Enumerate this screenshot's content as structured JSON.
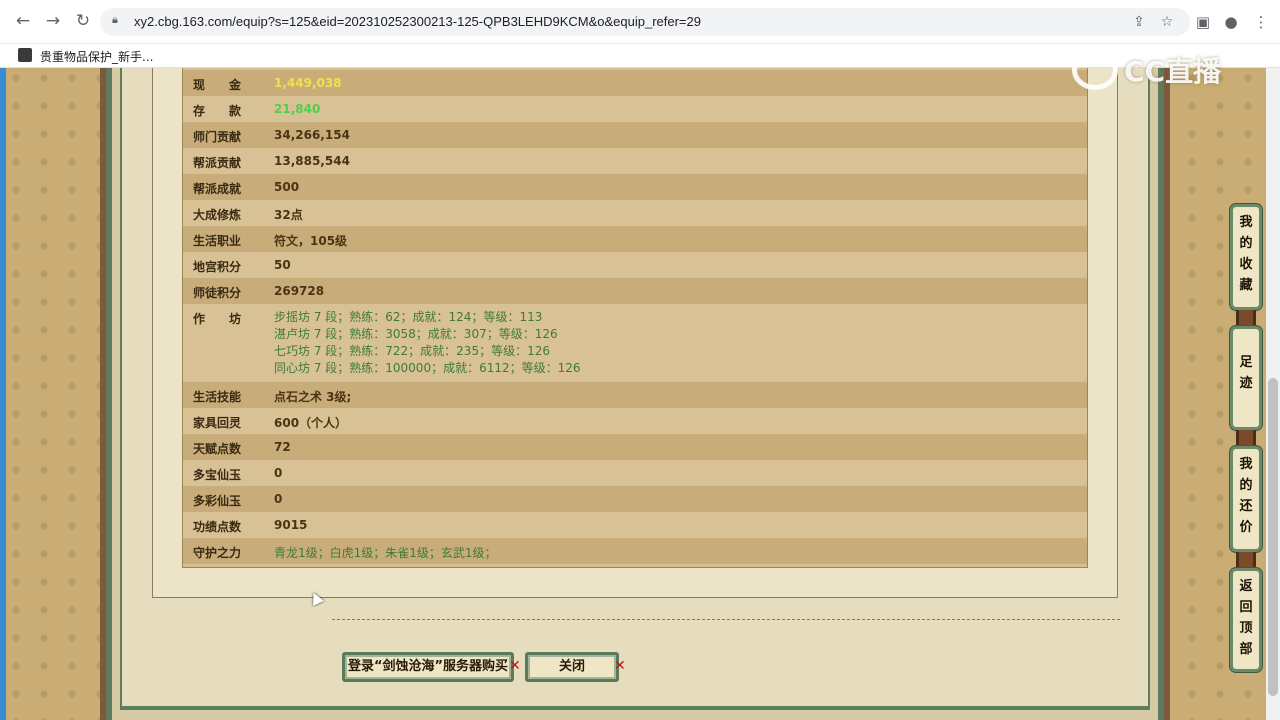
{
  "browser": {
    "url": "xy2.cbg.163.com/equip?s=125&eid=202310252300213-125-QPB3LEHD9KCM&o&equip_refer=29",
    "bookmark_label": "贵重物品保护_新手...",
    "nav_icons": [
      "back-icon",
      "forward-icon",
      "reload-icon"
    ],
    "right_icons": [
      "share-icon",
      "star-icon",
      "sidebar-icon",
      "profile-icon",
      "menu-icon"
    ]
  },
  "watermark": {
    "text": "CC直播"
  },
  "table": {
    "rows": [
      {
        "label": "现　　金",
        "value": "1,449,038",
        "style": "yellow"
      },
      {
        "label": "存　　款",
        "value": "21,840",
        "style": "bright-green"
      },
      {
        "label": "师门贡献",
        "value": "34,266,154"
      },
      {
        "label": "帮派贡献",
        "value": "13,885,544"
      },
      {
        "label": "帮派成就",
        "value": "500"
      },
      {
        "label": "大成修炼",
        "value": "32点"
      },
      {
        "label": "生活职业",
        "value": "符文，105级"
      },
      {
        "label": "地宫积分",
        "value": "50"
      },
      {
        "label": "师徒积分",
        "value": "269728"
      }
    ],
    "workshop": {
      "label": "作　　坊",
      "lines": [
        "步摇坊 7 段；熟练：62；成就：124；等级：113",
        "湛卢坊 7 段；熟练：3058；成就：307；等级：126",
        "七巧坊 7 段；熟练：722；成就：235；等级：126",
        "同心坊 7 段；熟练：100000；成就：6112；等级：126"
      ]
    },
    "rows_after": [
      {
        "label": "生活技能",
        "value": "点石之术 3级;"
      },
      {
        "label": "家具回灵",
        "value": "600（个人）"
      },
      {
        "label": "天赋点数",
        "value": "72"
      },
      {
        "label": "多宝仙玉",
        "value": "0"
      },
      {
        "label": "多彩仙玉",
        "value": "0"
      },
      {
        "label": "功绩点数",
        "value": "9015"
      },
      {
        "label": "守护之力",
        "value": "青龙1级；白虎1级；朱雀1级；玄武1级；",
        "style": "green"
      }
    ]
  },
  "buttons": {
    "login": "登录“剑蚀沧海”服务器购买",
    "close": "关闭"
  },
  "side_buttons": [
    {
      "label": "我的收藏"
    },
    {
      "label": "足迹"
    },
    {
      "label": "我的还价"
    },
    {
      "label": "返回顶部"
    }
  ],
  "colors": {
    "page_bg": "#c9ad74",
    "frame_green": "#5b7f5a",
    "row_dark": "#c8ad7a",
    "row_light": "#d8c195",
    "cash_yellow": "#f4e04a",
    "deposit_green": "#4ed04a",
    "value_green": "#3f7a3a"
  }
}
